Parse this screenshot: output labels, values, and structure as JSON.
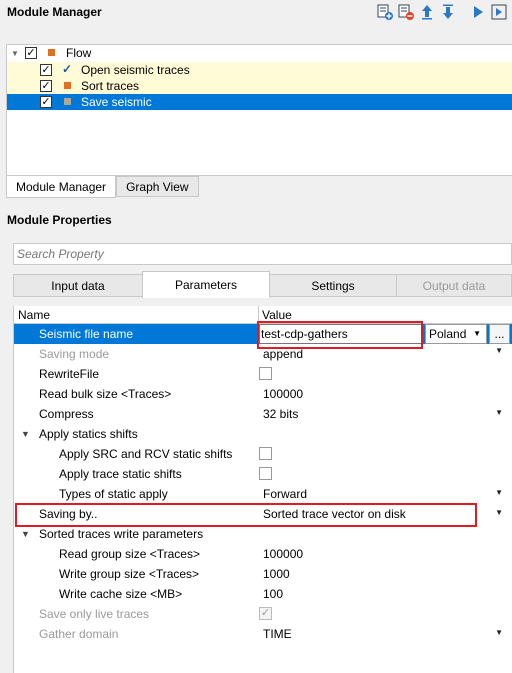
{
  "module_manager": {
    "title": "Module Manager",
    "toolbar_icons": [
      "add-module-icon",
      "remove-module-icon",
      "move-up-icon",
      "move-down-icon",
      "run-icon",
      "run-to-module-icon"
    ],
    "tree": {
      "root": "Flow",
      "items": [
        {
          "label": "Open seismic traces",
          "checked": true,
          "status": "check"
        },
        {
          "label": "Sort traces",
          "checked": true,
          "status": "square"
        },
        {
          "label": "Save seismic",
          "checked": true,
          "status": "square",
          "selected": true
        }
      ]
    },
    "tabs": [
      "Module Manager",
      "Graph View"
    ]
  },
  "module_properties": {
    "title": "Module Properties",
    "search_placeholder": "Search Property",
    "tabs": [
      "Input data",
      "Parameters",
      "Settings",
      "Output data"
    ],
    "columns": {
      "name": "Name",
      "value": "Value"
    },
    "rows": {
      "seismic_file_name": {
        "name": "Seismic file name",
        "value": "test-cdp-gathers",
        "region": "Poland",
        "browse": "..."
      },
      "saving_mode": {
        "name": "Saving mode",
        "value": "append"
      },
      "rewrite_file": {
        "name": "RewriteFile"
      },
      "read_bulk_size": {
        "name": "Read bulk size <Traces>",
        "value": "100000"
      },
      "compress": {
        "name": "Compress",
        "value": "32 bits"
      },
      "apply_statics": {
        "name": "Apply statics shifts"
      },
      "apply_src_rcv": {
        "name": "Apply SRC and RCV static shifts"
      },
      "apply_trace_static": {
        "name": "Apply trace static shifts"
      },
      "types_static": {
        "name": "Types of static apply",
        "value": "Forward"
      },
      "saving_by": {
        "name": "Saving by..",
        "value": "Sorted trace vector on disk"
      },
      "sorted_params": {
        "name": "Sorted traces write parameters"
      },
      "read_group_size": {
        "name": "Read group size <Traces>",
        "value": "100000"
      },
      "write_group_size": {
        "name": "Write group size <Traces>",
        "value": "1000"
      },
      "write_cache_size": {
        "name": "Write cache size <MB>",
        "value": "100"
      },
      "save_only_live": {
        "name": "Save only live traces"
      },
      "gather_domain": {
        "name": "Gather domain",
        "value": "TIME"
      }
    }
  },
  "colors": {
    "selection": "#0078d7",
    "highlight": "#e01b24",
    "module_square": "#e07020",
    "row_highlight": "#fffbd6"
  }
}
